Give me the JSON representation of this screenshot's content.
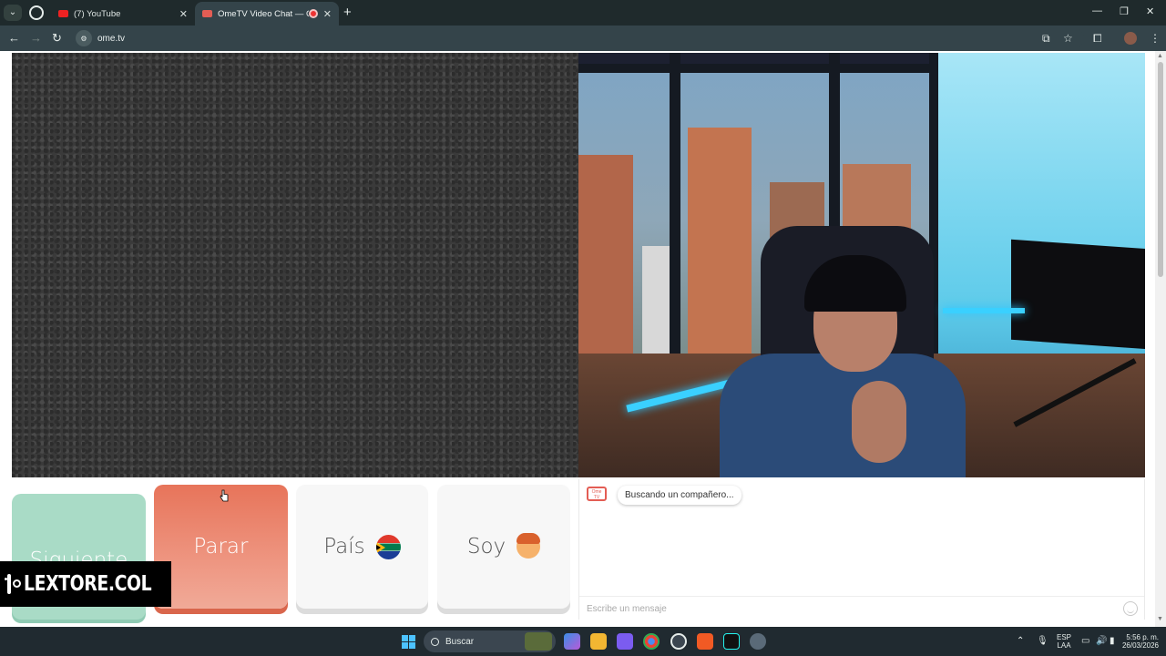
{
  "browser": {
    "tabs": [
      {
        "title": "(7) YouTube",
        "active": false
      },
      {
        "title": "OmeTV Video Chat — Ome",
        "active": true
      }
    ],
    "url": "ome.tv"
  },
  "controls": {
    "next_label": "Siguiente",
    "stop_label": "Parar",
    "country_label": "País",
    "me_label": "Soy"
  },
  "chat": {
    "status": "Buscando un compañero...",
    "input_placeholder": "Escribe un mensaje",
    "logo_text": "Ome TV"
  },
  "watermark": {
    "text": "LEXTORE.COL"
  },
  "taskbar": {
    "search_label": "Buscar",
    "lang_line1": "ESP",
    "lang_line2": "LAA",
    "time": "5:56 p. m.",
    "date": "26/03/2026"
  },
  "colors": {
    "next_button": "#a9dbc6",
    "stop_button": "#e7745a",
    "brand": "#e35d54"
  }
}
